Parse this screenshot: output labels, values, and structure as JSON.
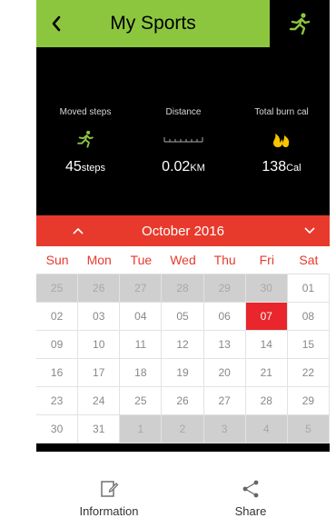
{
  "header": {
    "title": "My Sports"
  },
  "stats": [
    {
      "label": "Moved steps",
      "value": "45",
      "unit": "steps",
      "icon": "runner-icon"
    },
    {
      "label": "Distance",
      "value": "0.02",
      "unit": "KM",
      "icon": "ruler-icon"
    },
    {
      "label": "Total burn  cal",
      "value": "138",
      "unit": "Cal",
      "icon": "flame-icon"
    }
  ],
  "calendar": {
    "month": "October 2016",
    "weekdays": [
      "Sun",
      "Mon",
      "Tue",
      "Wed",
      "Thu",
      "Fri",
      "Sat"
    ],
    "rows": [
      [
        "25",
        "26",
        "27",
        "28",
        "29",
        "30",
        "01"
      ],
      [
        "02",
        "03",
        "04",
        "05",
        "06",
        "07",
        "08"
      ],
      [
        "09",
        "10",
        "11",
        "12",
        "13",
        "14",
        "15"
      ],
      [
        "16",
        "17",
        "18",
        "19",
        "20",
        "21",
        "22"
      ],
      [
        "23",
        "24",
        "25",
        "26",
        "27",
        "28",
        "29"
      ],
      [
        "30",
        "31",
        "1",
        "2",
        "3",
        "4",
        "5"
      ]
    ],
    "selected": "07"
  },
  "bottom": {
    "information_label": "Information",
    "share_label": "Share"
  },
  "colors": {
    "header_green": "#8cc63f",
    "accent_red": "#e83a2c",
    "runner_green": "#8cc63f",
    "flame_yellow": "#f7c600"
  }
}
